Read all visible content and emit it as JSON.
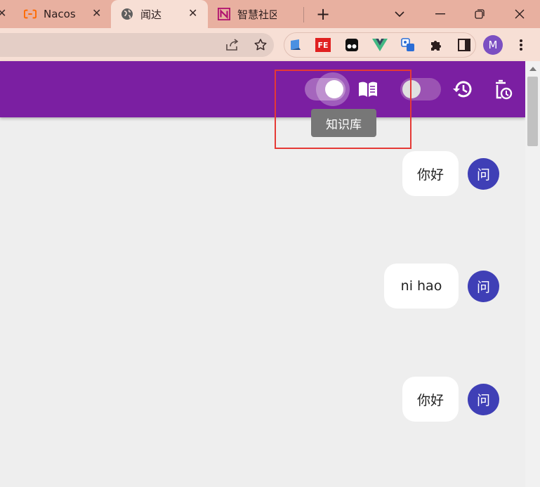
{
  "browser": {
    "tabs": [
      {
        "title": "",
        "icon": "close-icon",
        "partial": true
      },
      {
        "title": "Nacos",
        "icon": "alibaba-cloud-icon"
      },
      {
        "title": "闻达",
        "icon": "globe-icon",
        "active": true
      },
      {
        "title": "智慧社区",
        "icon": "brand-n-icon"
      }
    ],
    "new_tab_symbol": "+",
    "close_symbol": "✕",
    "avatar_letter": "M",
    "extensions": [
      "book-extension-icon",
      "fe-helper-icon",
      "tampermonkey-icon",
      "vue-devtools-icon",
      "translate-extension-icon",
      "puzzle-icon"
    ],
    "colors": {
      "tabstrip": "#e8b0a0",
      "toolbar": "#f7dfd5"
    }
  },
  "header": {
    "knowledge_switch_on": true,
    "second_switch_on": false,
    "tooltip": "知识库",
    "colors": {
      "bar": "#7b1fa2",
      "highlight": "#e53935"
    }
  },
  "messages": [
    {
      "text": "你好",
      "avatar": "问"
    },
    {
      "text": "ni hao",
      "avatar": "问"
    },
    {
      "text": "你好",
      "avatar": "问"
    }
  ]
}
